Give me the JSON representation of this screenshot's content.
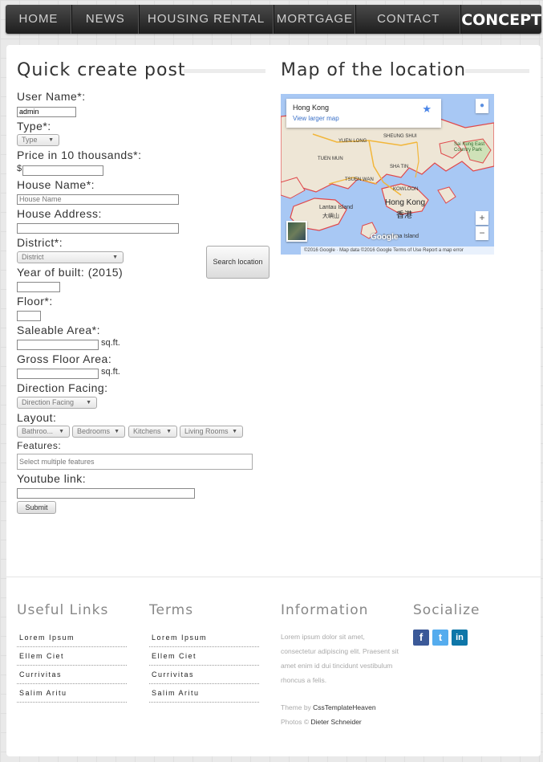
{
  "nav": {
    "items": [
      "HOME",
      "NEWS",
      "HOUSING RENTAL",
      "MORTGAGE",
      "CONTACT"
    ],
    "brand": "CONCEPT"
  },
  "form": {
    "title": "Quick create post",
    "username_label": "User Name*:",
    "username_value": "admin",
    "type_label": "Type*:",
    "type_select": "Type",
    "price_label": "Price in 10 thousands*:",
    "price_prefix": "$",
    "house_name_label": "House Name*:",
    "house_name_placeholder": "House Name",
    "house_address_label": "House Address:",
    "district_label": "District*:",
    "district_select": "District",
    "search_location_button": "Search location",
    "year_label": "Year of built: (2015)",
    "floor_label": "Floor*:",
    "saleable_label": "Saleable Area*:",
    "area_unit": "sq.ft.",
    "gross_label": "Gross Floor Area:",
    "direction_label": "Direction Facing:",
    "direction_select": "Direction Facing",
    "layout_label": "Layout:",
    "layout_selects": [
      "Bathroo...",
      "Bedrooms",
      "Kitchens",
      "Living Rooms"
    ],
    "features_label": "Features:",
    "features_placeholder": "Select multiple features",
    "youtube_label": "Youtube link:",
    "submit_button": "Submit"
  },
  "map": {
    "title": "Map of the location",
    "card_place": "Hong Kong",
    "card_link": "View larger map",
    "zoom_in": "+",
    "zoom_out": "−",
    "google_logo": "Google",
    "attribution": "©2016 Google · Map data ©2016 Google    Terms of Use    Report a map error",
    "labels": {
      "hong_kong": "Hong Kong",
      "hong_kong_cn": "香港",
      "lantau": "Lantau Island",
      "lantau_cn": "大嶼山",
      "sai_kung": "Sai Kung East Country Park",
      "tuen_mun": "TUEN MUN",
      "yuen_long": "YUEN LONG",
      "sheung_shui": "SHEUNG SHUI",
      "sha_tin": "SHA TIN",
      "tsuen_wan": "TSUEN WAN",
      "kowloon": "KOWLOON",
      "lamma": "Lamma Island"
    }
  },
  "footer": {
    "useful_links_title": "Useful Links",
    "useful_links": [
      "Lorem Ipsum",
      "Ellem Ciet",
      "Currivitas",
      "Salim Aritu"
    ],
    "terms_title": "Terms",
    "terms_links": [
      "Lorem Ipsum",
      "Ellem Ciet",
      "Currivitas",
      "Salim Aritu"
    ],
    "info_title": "Information",
    "info_text": "Lorem ipsum dolor sit amet, consectetur adipiscing elit. Praesent sit amet enim id dui tincidunt vestibulum rhoncus a felis.",
    "theme_by_prefix": "Theme by ",
    "theme_by": "CssTemplateHeaven",
    "photos_prefix": "Photos © ",
    "photos_by": "Dieter Schneider",
    "socialize_title": "Socialize",
    "social_icons": [
      "facebook-icon",
      "twitter-icon",
      "linkedin-icon"
    ],
    "social_colors": [
      "#3b5998",
      "#55acee",
      "#0e76a8"
    ]
  }
}
